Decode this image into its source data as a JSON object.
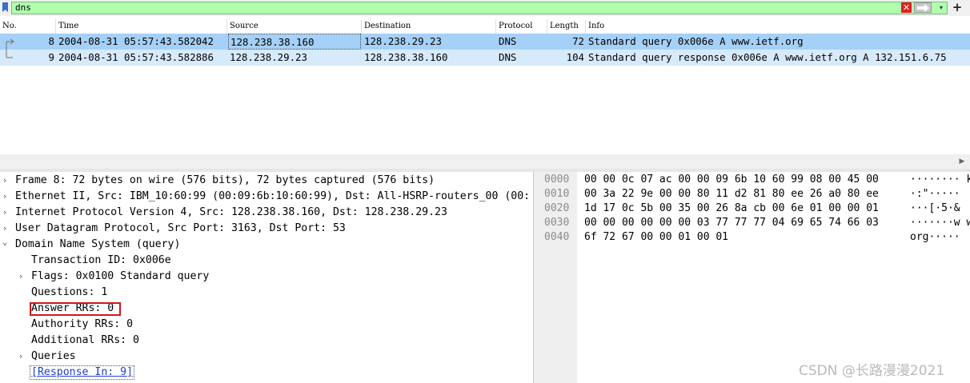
{
  "filter": {
    "value": "dns",
    "bookmark_icon": "bookmark-icon",
    "clear_icon": "clear-x-icon",
    "clear_glyph": "✕",
    "apply_icon": "arrow-right-icon",
    "dropdown_glyph": "▾",
    "add_glyph": "+",
    "bg_color": "#afffaf"
  },
  "packet_list": {
    "columns": [
      "No.",
      "Time",
      "Source",
      "Destination",
      "Protocol",
      "Length",
      "Info"
    ],
    "rows": [
      {
        "no": "8",
        "time": "2004-08-31 05:57:43.582042",
        "source": "128.238.38.160",
        "destination": "128.238.29.23",
        "protocol": "DNS",
        "length": "72",
        "info": "Standard query 0x006e A www.ietf.org",
        "selected": true
      },
      {
        "no": "9",
        "time": "2004-08-31 05:57:43.582886",
        "source": "128.238.29.23",
        "destination": "128.238.38.160",
        "protocol": "DNS",
        "length": "104",
        "info": "Standard query response 0x006e A www.ietf.org A 132.151.6.75",
        "selected": false
      }
    ],
    "selected_color": "#a5d0f7",
    "related_color": "#d7eafc"
  },
  "details": {
    "frame": "Frame 8: 72 bytes on wire (576 bits), 72 bytes captured (576 bits)",
    "ethernet": "Ethernet II, Src: IBM_10:60:99 (00:09:6b:10:60:99), Dst: All-HSRP-routers_00 (00:",
    "ip": "Internet Protocol Version 4, Src: 128.238.38.160, Dst: 128.238.29.23",
    "udp": "User Datagram Protocol, Src Port: 3163, Dst Port: 53",
    "dns": "Domain Name System (query)",
    "transaction_id": "Transaction ID: 0x006e",
    "flags": "Flags: 0x0100 Standard query",
    "questions": "Questions: 1",
    "answer_rrs": "Answer RRs: 0",
    "authority_rrs": "Authority RRs: 0",
    "additional_rrs": "Additional RRs: 0",
    "queries": "Queries",
    "response_in": "[Response In: 9]",
    "collapsed_glyph": "›",
    "expanded_glyph": "⌄",
    "highlight_color": "#d01818"
  },
  "bytes": {
    "rows": [
      {
        "offset": "0000",
        "hex": "00 00 0c 07 ac 00 00 09  6b 10 60 99 08 00 45 00",
        "ascii": "········ k"
      },
      {
        "offset": "0010",
        "hex": "00 3a 22 9e 00 00 80 11  d2 81 80 ee 26 a0 80 ee",
        "ascii": "·:\"·····"
      },
      {
        "offset": "0020",
        "hex": "1d 17 0c 5b 00 35 00 26  8a cb 00 6e 01 00 00 01",
        "ascii": "···[·5·&"
      },
      {
        "offset": "0030",
        "hex": "00 00 00 00 00 00 03 77  77 77 04 69 65 74 66 03",
        "ascii": "·······w w"
      },
      {
        "offset": "0040",
        "hex": "6f 72 67 00 00 01 00 01",
        "ascii": "org·····"
      }
    ]
  },
  "watermark": "CSDN @长路漫漫2021"
}
